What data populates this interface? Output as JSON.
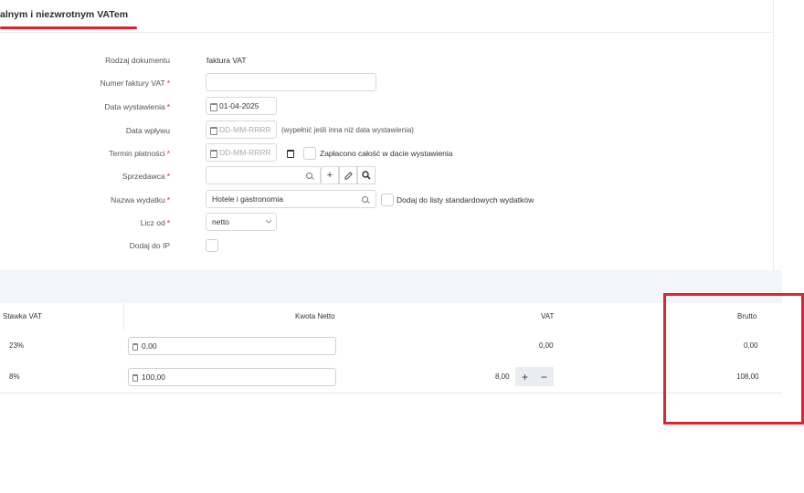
{
  "header": {
    "title": "alnym i niezwrotnym VATem"
  },
  "form": {
    "rodzaj": {
      "label": "Rodzaj dokumentu",
      "value": "faktura VAT"
    },
    "numer": {
      "label": "Numer faktury VAT",
      "required": "*",
      "value": ""
    },
    "data_wystawienia": {
      "label": "Data wystawienia",
      "required": "*",
      "value": "01-04-2025"
    },
    "data_wplywu": {
      "label": "Data wpływu",
      "placeholder": "DD-MM-RRRR",
      "hint": "(wypełnić jeśli inna niż data wystawienia)"
    },
    "termin": {
      "label": "Termin płatności",
      "required": "*",
      "placeholder": "DD-MM-RRRR",
      "checkbox_label": "Zapłacono całość w dacie wystawienia"
    },
    "sprzedawca": {
      "label": "Sprzedawca",
      "required": "*",
      "value": ""
    },
    "nazwa_wydatku": {
      "label": "Nazwa wydatku",
      "required": "*",
      "value": "Hotele i gastronomia",
      "checkbox_label": "Dodaj do listy standardowych wydatków"
    },
    "licz_od": {
      "label": "Licz od",
      "required": "*",
      "value": "netto"
    },
    "dodaj_do_ip": {
      "label": "Dodaj do IP"
    }
  },
  "table": {
    "headers": {
      "stawka": "Stawka VAT",
      "netto": "Kwota Netto",
      "vat": "VAT",
      "brutto": "Brutto"
    },
    "rows": [
      {
        "stawka": "23%",
        "netto": "0,00",
        "vat": "0,00",
        "brutto": "0,00"
      },
      {
        "stawka": "8%",
        "netto": "100,00",
        "vat": "8,00",
        "brutto": "108,00"
      }
    ],
    "plus": "+",
    "minus": "−"
  },
  "colors": {
    "accent": "#e0232e"
  }
}
